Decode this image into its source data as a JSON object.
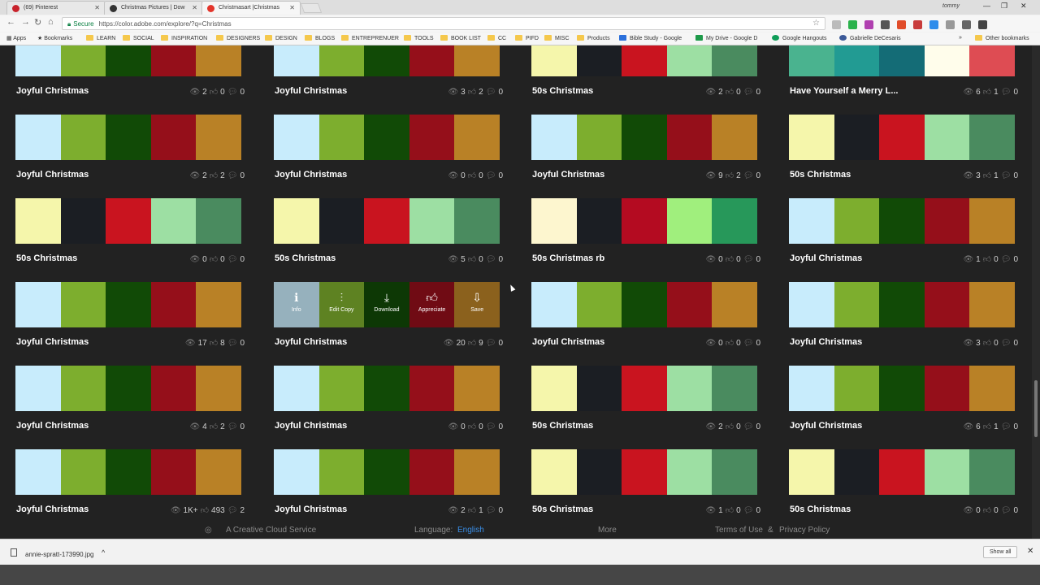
{
  "browser": {
    "tabs": [
      {
        "label": "(69) Pinterest",
        "color": "#c8232c"
      },
      {
        "label": "Christmas Pictures | Dow",
        "color": "#333333"
      },
      {
        "label": "Christmasart |Christmas",
        "color": "#e3352b"
      }
    ],
    "user": "tommy",
    "secure_label": "Secure",
    "url": "https://color.adobe.com/explore/?q=Christmas",
    "bookmarks": [
      {
        "label": "Apps"
      },
      {
        "label": "Bookmarks"
      },
      {
        "label": "LEARN"
      },
      {
        "label": "SOCIAL"
      },
      {
        "label": "INSPIRATION"
      },
      {
        "label": "DESIGNERS"
      },
      {
        "label": "DESIGN"
      },
      {
        "label": "BLOGS"
      },
      {
        "label": "ENTREPRENUER"
      },
      {
        "label": "TOOLS"
      },
      {
        "label": "BOOK LIST"
      },
      {
        "label": "CC"
      },
      {
        "label": "PIFD"
      },
      {
        "label": "MISC"
      },
      {
        "label": "Products"
      },
      {
        "label": "Bible Study - Google"
      },
      {
        "label": "My Drive - Google D"
      },
      {
        "label": "Google Hangouts"
      },
      {
        "label": "Gabrielle DeCesaris"
      },
      {
        "label": "Other bookmarks"
      }
    ]
  },
  "palettes": {
    "joyful": [
      "#c8ecfc",
      "#7dae2e",
      "#114a06",
      "#950f1a",
      "#b98126"
    ],
    "fifties": [
      "#f5f6ab",
      "#1b1e23",
      "#c9141f",
      "#9ddfa3",
      "#4a8b5f"
    ],
    "merry": [
      "#4ab38f",
      "#229b93",
      "#146c76",
      "#fffdeb",
      "#de4c53"
    ],
    "rb": [
      "#fdf6cf",
      "#1b1e23",
      "#b40b21",
      "#a0ef7d",
      "#27985a"
    ]
  },
  "cards": [
    {
      "title": "Joyful Christmas",
      "palette": "joyful",
      "views": "2",
      "likes": "0",
      "comments": "0"
    },
    {
      "title": "Joyful Christmas",
      "palette": "joyful",
      "views": "3",
      "likes": "2",
      "comments": "0"
    },
    {
      "title": "50s Christmas",
      "palette": "fifties",
      "views": "2",
      "likes": "0",
      "comments": "0"
    },
    {
      "title": "Have Yourself a Merry L...",
      "palette": "merry",
      "views": "6",
      "likes": "1",
      "comments": "0"
    },
    {
      "title": "Joyful Christmas",
      "palette": "joyful",
      "views": "2",
      "likes": "2",
      "comments": "0"
    },
    {
      "title": "Joyful Christmas",
      "palette": "joyful",
      "views": "0",
      "likes": "0",
      "comments": "0"
    },
    {
      "title": "Joyful Christmas",
      "palette": "joyful",
      "views": "9",
      "likes": "2",
      "comments": "0"
    },
    {
      "title": "50s Christmas",
      "palette": "fifties",
      "views": "3",
      "likes": "1",
      "comments": "0"
    },
    {
      "title": "50s Christmas",
      "palette": "fifties",
      "views": "0",
      "likes": "0",
      "comments": "0"
    },
    {
      "title": "50s Christmas",
      "palette": "fifties",
      "views": "5",
      "likes": "0",
      "comments": "0"
    },
    {
      "title": "50s Christmas rb",
      "palette": "rb",
      "views": "0",
      "likes": "0",
      "comments": "0"
    },
    {
      "title": "Joyful Christmas",
      "palette": "joyful",
      "views": "1",
      "likes": "0",
      "comments": "0"
    },
    {
      "title": "Joyful Christmas",
      "palette": "joyful",
      "views": "17",
      "likes": "8",
      "comments": "0"
    },
    {
      "title": "Joyful Christmas",
      "palette": "joyful",
      "views": "20",
      "likes": "9",
      "comments": "0",
      "hover": true
    },
    {
      "title": "Joyful Christmas",
      "palette": "joyful",
      "views": "0",
      "likes": "0",
      "comments": "0"
    },
    {
      "title": "Joyful Christmas",
      "palette": "joyful",
      "views": "3",
      "likes": "0",
      "comments": "0"
    },
    {
      "title": "Joyful Christmas",
      "palette": "joyful",
      "views": "4",
      "likes": "2",
      "comments": "0"
    },
    {
      "title": "Joyful Christmas",
      "palette": "joyful",
      "views": "0",
      "likes": "0",
      "comments": "0"
    },
    {
      "title": "50s Christmas",
      "palette": "fifties",
      "views": "2",
      "likes": "0",
      "comments": "0"
    },
    {
      "title": "Joyful Christmas",
      "palette": "joyful",
      "views": "6",
      "likes": "1",
      "comments": "0"
    },
    {
      "title": "Joyful Christmas",
      "palette": "joyful",
      "views": "1K+",
      "likes": "493",
      "comments": "2"
    },
    {
      "title": "Joyful Christmas",
      "palette": "joyful",
      "views": "2",
      "likes": "1",
      "comments": "0"
    },
    {
      "title": "50s Christmas",
      "palette": "fifties",
      "views": "1",
      "likes": "0",
      "comments": "0"
    },
    {
      "title": "50s Christmas",
      "palette": "fifties",
      "views": "0",
      "likes": "0",
      "comments": "0"
    }
  ],
  "hover_actions": [
    {
      "label": "Info",
      "icon": "info-icon"
    },
    {
      "label": "Edit Copy",
      "icon": "sliders-icon"
    },
    {
      "label": "Download",
      "icon": "download-icon"
    },
    {
      "label": "Appreciate",
      "icon": "thumbs-up-icon"
    },
    {
      "label": "Save",
      "icon": "save-icon"
    }
  ],
  "footer": {
    "service": "A Creative Cloud Service",
    "language_label": "Language:",
    "language_value": "English",
    "more": "More",
    "terms": "Terms of Use",
    "amp": "&",
    "privacy": "Privacy Policy"
  },
  "download_bar": {
    "filename": "annie-spratt-173990.jpg",
    "show_all": "Show all"
  }
}
